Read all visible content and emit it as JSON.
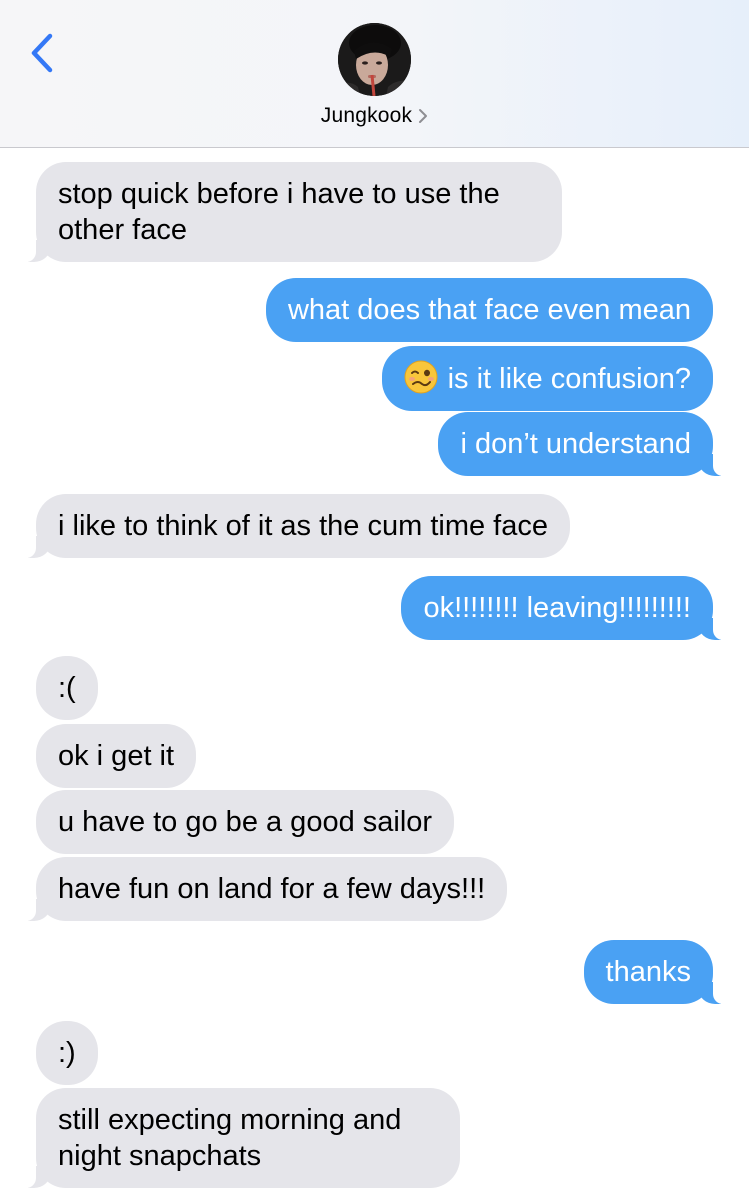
{
  "header": {
    "contact_name": "Jungkook",
    "back_icon": "chevron-left-icon",
    "chevron_icon": "chevron-right-icon",
    "avatar": "contact-avatar-photo",
    "accent_color": "#3478f6"
  },
  "colors": {
    "incoming_bubble": "#e5e5ea",
    "outgoing_bubble": "#4aa1f3"
  },
  "messages": [
    {
      "direction": "incoming",
      "line1": "stop quick before i have to use the",
      "line2": "other face"
    },
    {
      "direction": "outgoing",
      "text": "what does that face even mean"
    },
    {
      "direction": "outgoing",
      "emoji": "woozy-face-icon",
      "text": "is it like confusion?"
    },
    {
      "direction": "outgoing",
      "text": "i don’t understand"
    },
    {
      "direction": "incoming",
      "text": "i like to think of it as the cum time face"
    },
    {
      "direction": "outgoing",
      "text": "ok!!!!!!!! leaving!!!!!!!!!"
    },
    {
      "direction": "incoming",
      "text": ":("
    },
    {
      "direction": "incoming",
      "text": "ok i get it"
    },
    {
      "direction": "incoming",
      "text": "u have to go be a good sailor"
    },
    {
      "direction": "incoming",
      "text": "have fun on land for a few days!!!"
    },
    {
      "direction": "outgoing",
      "text": "thanks"
    },
    {
      "direction": "incoming",
      "text": ":)"
    },
    {
      "direction": "incoming",
      "line1": "still expecting morning and",
      "line2": "night snapchats"
    }
  ]
}
